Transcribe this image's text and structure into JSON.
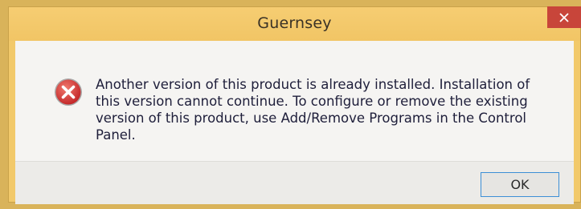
{
  "window": {
    "title": "Guernsey",
    "close_icon": "close-icon"
  },
  "dialog": {
    "icon": "error-icon",
    "message": "Another version of this product is already installed. Installation of this version cannot continue. To configure or remove the existing version of this product, use Add/Remove Programs in the Control Panel.",
    "ok_label": "OK"
  },
  "colors": {
    "titlebar": "#f2c96a",
    "close_button": "#c8453a",
    "error_icon": "#d43b3b",
    "ok_button_border": "#3c8fd6"
  }
}
